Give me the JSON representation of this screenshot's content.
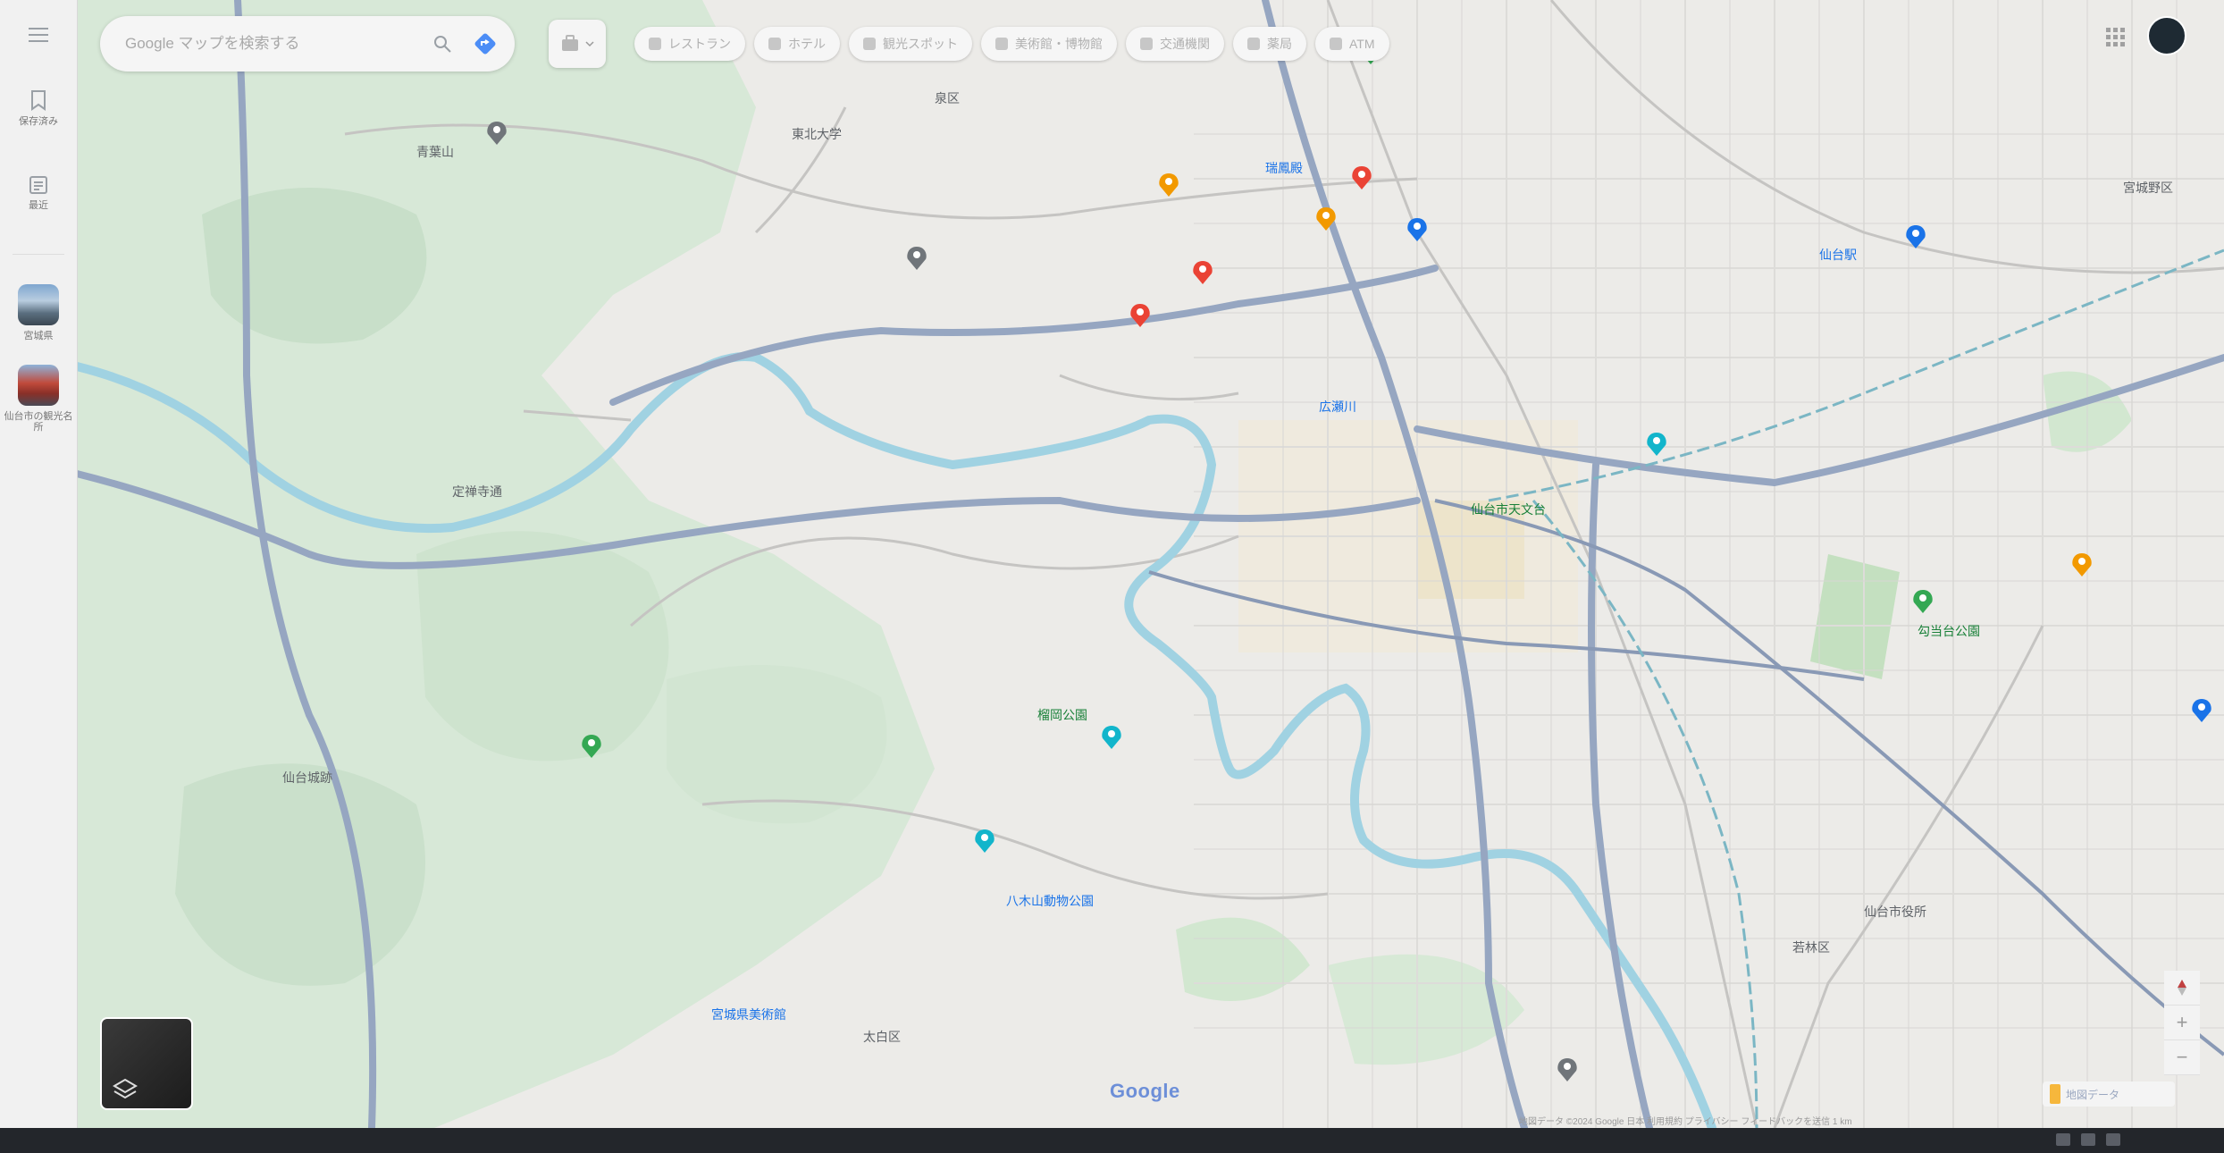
{
  "search": {
    "placeholder": "Google マップを検索する",
    "value": ""
  },
  "rail": {
    "saved_label": "保存済み",
    "recent_label": "最近",
    "history": [
      {
        "label": "宮城県"
      },
      {
        "label": "仙台市の観光名所"
      }
    ]
  },
  "chips": [
    {
      "label": "レストラン"
    },
    {
      "label": "ホテル"
    },
    {
      "label": "観光スポット"
    },
    {
      "label": "美術館・博物館"
    },
    {
      "label": "交通機関"
    },
    {
      "label": "薬局"
    },
    {
      "label": "ATM"
    }
  ],
  "map": {
    "google_logo": "Google",
    "scale_text": "地図データ",
    "footer": "地図データ ©2024 Google 日本 利用規約 プライバシー フィードバックを送信 1 km",
    "place_labels": [
      {
        "text": "青葉山",
        "color": "#5f6368"
      },
      {
        "text": "瑞鳳殿",
        "color": "#1a73e8"
      },
      {
        "text": "東北大学",
        "color": "#5f6368"
      },
      {
        "text": "仙台城跡",
        "color": "#5f6368"
      },
      {
        "text": "仙台駅",
        "color": "#1a73e8"
      },
      {
        "text": "勾当台公園",
        "color": "#188038"
      },
      {
        "text": "榴岡公園",
        "color": "#188038"
      },
      {
        "text": "八木山動物公園",
        "color": "#1a73e8"
      },
      {
        "text": "宮城県美術館",
        "color": "#1a73e8"
      },
      {
        "text": "仙台市天文台",
        "color": "#188038"
      },
      {
        "text": "定禅寺通",
        "color": "#5f6368"
      },
      {
        "text": "広瀬川",
        "color": "#1a73e8"
      },
      {
        "text": "仙台市役所",
        "color": "#5f6368"
      },
      {
        "text": "宮城野区",
        "color": "#5f6368"
      },
      {
        "text": "若林区",
        "color": "#5f6368"
      },
      {
        "text": "太白区",
        "color": "#5f6368"
      },
      {
        "text": "泉区",
        "color": "#5f6368"
      }
    ],
    "pins": [
      {
        "color": "#ea4335"
      },
      {
        "color": "#ea4335"
      },
      {
        "color": "#ea4335"
      },
      {
        "color": "#f29900"
      },
      {
        "color": "#f29900"
      },
      {
        "color": "#f29900"
      },
      {
        "color": "#1a73e8"
      },
      {
        "color": "#1a73e8"
      },
      {
        "color": "#1a73e8"
      },
      {
        "color": "#12b5cb"
      },
      {
        "color": "#12b5cb"
      },
      {
        "color": "#12b5cb"
      },
      {
        "color": "#34a853"
      },
      {
        "color": "#34a853"
      },
      {
        "color": "#34a853"
      },
      {
        "color": "#70757a"
      },
      {
        "color": "#70757a"
      },
      {
        "color": "#70757a"
      }
    ]
  },
  "taskbar": {
    "clock": ""
  }
}
